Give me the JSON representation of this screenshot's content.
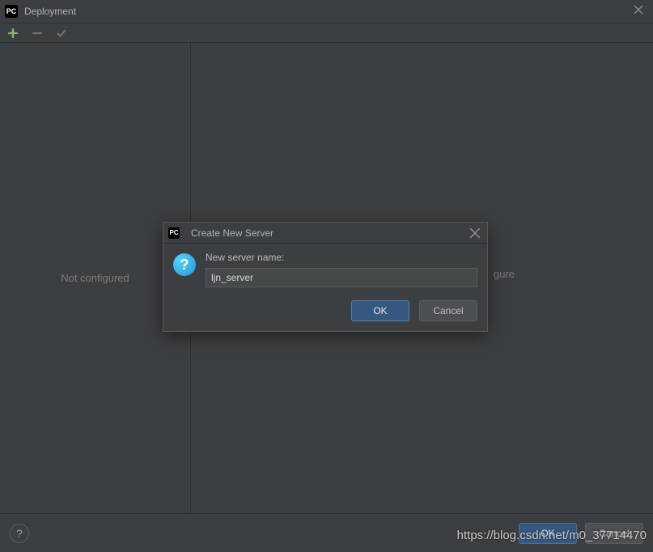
{
  "window": {
    "title": "Deployment",
    "close_tooltip": "Close"
  },
  "toolbar": {
    "add_tooltip": "Add",
    "remove_tooltip": "Remove",
    "apply_tooltip": "Apply"
  },
  "sidebar": {
    "placeholder": "Not configured"
  },
  "main": {
    "placeholder_suffix": "gure"
  },
  "footer": {
    "help_label": "?",
    "ok_label": "OK",
    "cancel_label": "Cancel"
  },
  "modal": {
    "title": "Create New Server",
    "label": "New server name:",
    "value": "ljn_server",
    "ok_label": "OK",
    "cancel_label": "Cancel",
    "icon_text": "?"
  },
  "watermark": "https://blog.csdn.net/m0_37714470"
}
